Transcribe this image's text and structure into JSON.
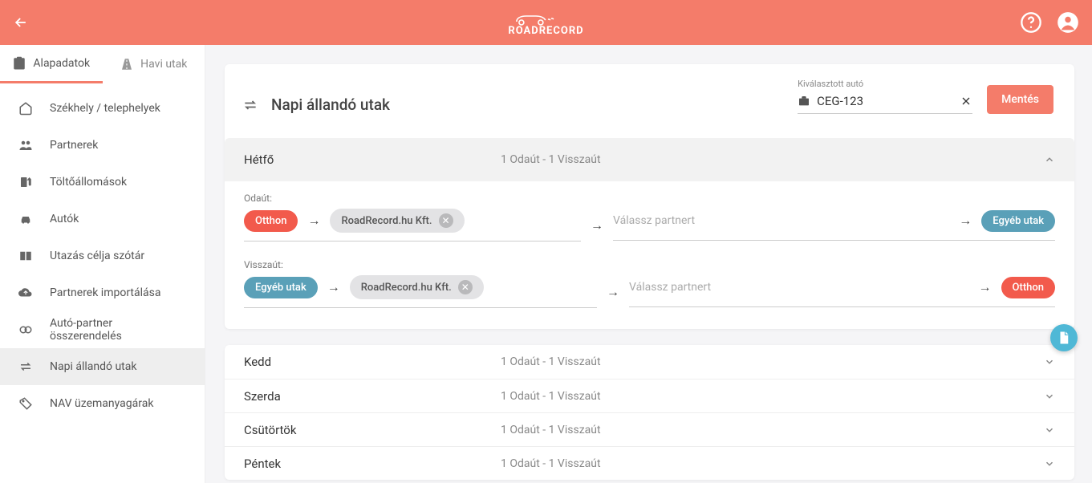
{
  "brand": "ROADRECORD",
  "tabs": [
    {
      "label": "Alapadatok",
      "active": true
    },
    {
      "label": "Havi utak",
      "active": false
    }
  ],
  "sidebar": {
    "items": [
      {
        "label": "Székhely / telephelyek"
      },
      {
        "label": "Partnerek"
      },
      {
        "label": "Töltőállomások"
      },
      {
        "label": "Autók"
      },
      {
        "label": "Utazás célja szótár"
      },
      {
        "label": "Partnerek importálása"
      },
      {
        "label": "Autó-partner összerendelés"
      },
      {
        "label": "Napi állandó utak"
      },
      {
        "label": "NAV üzemanyagárak"
      }
    ]
  },
  "page": {
    "title": "Napi állandó utak",
    "car_label": "Kiválasztott autó",
    "car_value": "CEG-123",
    "save": "Mentés"
  },
  "expanded_day": {
    "name": "Hétfő",
    "summary": "1 Odaút - 1 Visszaút",
    "out_label": "Odaút:",
    "back_label": "Visszaút:",
    "partner_placeholder": "Válassz partnert",
    "out": {
      "start": "Otthon",
      "chip": "RoadRecord.hu Kft.",
      "end": "Egyéb utak"
    },
    "back": {
      "start": "Egyéb utak",
      "chip": "RoadRecord.hu Kft.",
      "end": "Otthon"
    }
  },
  "collapsed_days": [
    {
      "name": "Kedd",
      "summary": "1 Odaút - 1 Visszaút"
    },
    {
      "name": "Szerda",
      "summary": "1 Odaút - 1 Visszaút"
    },
    {
      "name": "Csütörtök",
      "summary": "1 Odaút - 1 Visszaút"
    },
    {
      "name": "Péntek",
      "summary": "1 Odaút - 1 Visszaút"
    }
  ]
}
